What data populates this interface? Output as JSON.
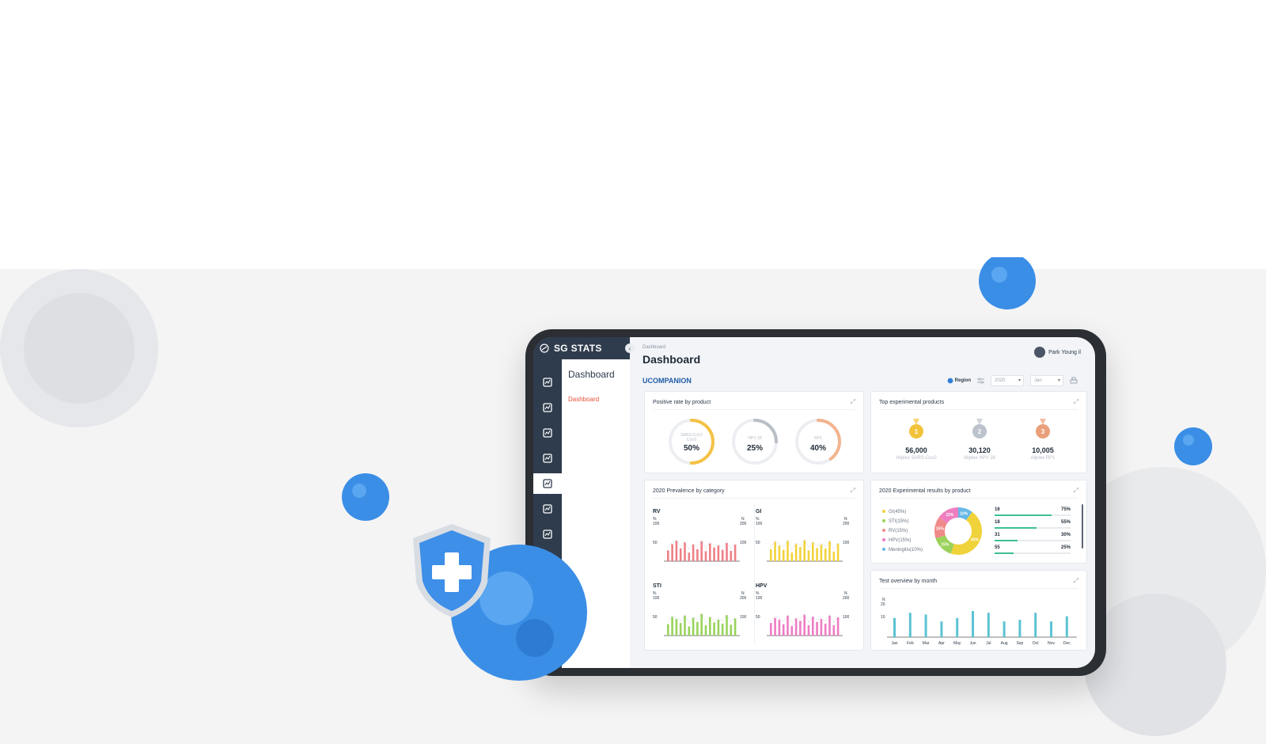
{
  "app": {
    "brand": "SG STATS",
    "breadcrumb": "Dashboard",
    "page_title": "Dashboard",
    "panel_title": "Dashboard",
    "panel_link": "Dashboard",
    "user_name": "Park Young il",
    "section": "UCOMPANION",
    "filters": {
      "region_label": "Region",
      "year": "2020",
      "month": "Jan"
    },
    "rail_icons": [
      "line-chart-icon",
      "presentation-icon",
      "users-map-icon",
      "report-icon",
      "monitor-icon",
      "device-icon",
      "tools-icon"
    ]
  },
  "cards": {
    "positive_rate": {
      "title": "Positive rate by product",
      "gauges": [
        {
          "label_line1": "SARS-CoV2",
          "label_line2": "CoV2",
          "value": "50%",
          "fraction": 0.5,
          "color": "#f5c246"
        },
        {
          "label_line1": "HPV 28",
          "label_line2": "",
          "value": "25%",
          "fraction": 0.25,
          "color": "#b9bfc7"
        },
        {
          "label_line1": "RP1",
          "label_line2": "",
          "value": "40%",
          "fraction": 0.4,
          "color": "#f2b48f"
        }
      ]
    },
    "top_products": {
      "title": "Top experimental products",
      "medals": [
        {
          "rank": "1",
          "value": "56,000",
          "name": "Allplex SARS-Cov2",
          "color": "#f2c23a"
        },
        {
          "rank": "2",
          "value": "30,120",
          "name": "Allplex HPV 28",
          "color": "#bcc3cc"
        },
        {
          "rank": "3",
          "value": "10,005",
          "name": "Allplex RP1",
          "color": "#e9a07a"
        }
      ]
    },
    "prevalence": {
      "title": "2020 Prevalence by category",
      "axis": {
        "left_unit": "%",
        "right_unit": "N",
        "left_max": "100",
        "left_mid": "50",
        "right_max": "200",
        "right_mid": "100"
      }
    },
    "exp_results": {
      "title": "2020 Experimental results by product",
      "legend": [
        {
          "label": "GI(45%)",
          "color": "#f0d23a"
        },
        {
          "label": "STI(15%)",
          "color": "#9ad15a"
        },
        {
          "label": "RV(15%)",
          "color": "#f08a8a"
        },
        {
          "label": "HPV(15%)",
          "color": "#ee7ec0"
        },
        {
          "label": "Meningitis(10%)",
          "color": "#67b9e8"
        }
      ],
      "donut_labels": [
        "10%",
        "45%",
        "15%",
        "15%",
        "15%"
      ],
      "progress": [
        {
          "left": "16",
          "right": "75%",
          "fraction": 0.75
        },
        {
          "left": "18",
          "right": "55%",
          "fraction": 0.55
        },
        {
          "left": "31",
          "right": "30%",
          "fraction": 0.3
        },
        {
          "left": "55",
          "right": "25%",
          "fraction": 0.25
        }
      ]
    },
    "test_overview": {
      "title": "Test overview by month",
      "axis": {
        "unit": "N",
        "max": "20",
        "mid": "10"
      }
    }
  },
  "chart_data": [
    {
      "type": "donut",
      "title": "2020 Experimental results by product",
      "categories": [
        "GI",
        "STI",
        "RV",
        "HPV",
        "Meningitis"
      ],
      "values": [
        45,
        15,
        15,
        15,
        10
      ],
      "colors": [
        "#f0d23a",
        "#9ad15a",
        "#f08a8a",
        "#ee7ec0",
        "#67b9e8"
      ]
    },
    {
      "type": "bar",
      "title": "RV",
      "color": "#ee7f86",
      "values": [
        38,
        60,
        72,
        45,
        66,
        30,
        58,
        42,
        70,
        35,
        62,
        48,
        55,
        40,
        64,
        36,
        58
      ]
    },
    {
      "type": "bar",
      "title": "GI",
      "color": "#f2d33b",
      "values": [
        42,
        68,
        55,
        40,
        72,
        30,
        60,
        50,
        74,
        38,
        66,
        46,
        58,
        44,
        70,
        34,
        62
      ]
    },
    {
      "type": "bar",
      "title": "STI",
      "color": "#98d35b",
      "values": [
        40,
        66,
        58,
        44,
        70,
        32,
        62,
        48,
        76,
        36,
        64,
        46,
        56,
        42,
        72,
        38,
        60
      ]
    },
    {
      "type": "bar",
      "title": "HPV",
      "color": "#ee7cc4",
      "values": [
        44,
        62,
        56,
        40,
        70,
        34,
        60,
        52,
        74,
        36,
        66,
        48,
        58,
        42,
        70,
        36,
        64
      ]
    },
    {
      "type": "bar",
      "title": "Test overview by month",
      "categories": [
        "Jan",
        "Feb",
        "Mar",
        "Apr",
        "May",
        "Jun",
        "Jul",
        "Aug",
        "Sep",
        "Oct",
        "Nov",
        "Dec"
      ],
      "values": [
        11,
        14,
        13,
        9,
        11,
        15,
        14,
        9,
        10,
        14,
        9,
        12
      ],
      "ylim": [
        0,
        20
      ],
      "color": "#5bc3d3"
    }
  ]
}
